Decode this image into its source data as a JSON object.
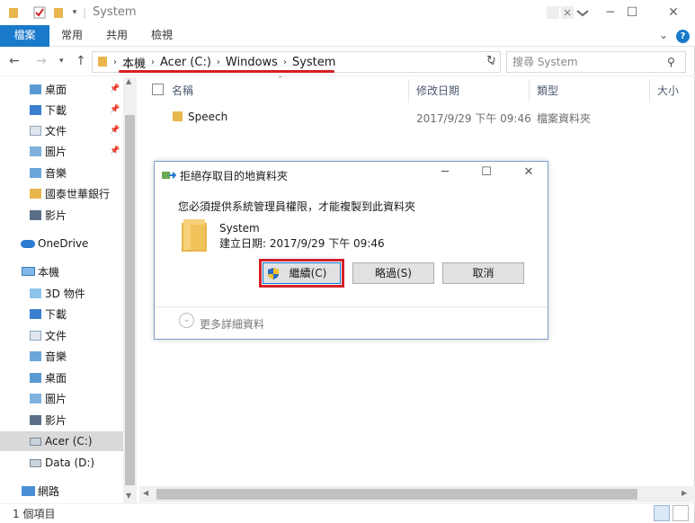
{
  "window": {
    "title": "System"
  },
  "ribbon": {
    "tabs": [
      "檔案",
      "常用",
      "共用",
      "檢視"
    ]
  },
  "address": {
    "crumbs": [
      "本機",
      "Acer (C:)",
      "Windows",
      "System"
    ],
    "search_placeholder": "搜尋 System"
  },
  "sidebar": {
    "quick_access": [
      {
        "label": "桌面",
        "pinned": true
      },
      {
        "label": "下載",
        "pinned": true
      },
      {
        "label": "文件",
        "pinned": true
      },
      {
        "label": "圖片",
        "pinned": true
      },
      {
        "label": "音樂",
        "pinned": false
      },
      {
        "label": "國泰世華銀行",
        "pinned": false
      },
      {
        "label": "影片",
        "pinned": false
      }
    ],
    "onedrive": "OneDrive",
    "this_pc": "本機",
    "pc_items": [
      "3D 物件",
      "下載",
      "文件",
      "音樂",
      "桌面",
      "圖片",
      "影片",
      "Acer (C:)",
      "Data (D:)"
    ],
    "network": "網路"
  },
  "columns": {
    "name": "名稱",
    "modified": "修改日期",
    "type": "類型",
    "size": "大小"
  },
  "rows": [
    {
      "name": "Speech",
      "modified": "2017/9/29 下午 09:46",
      "type": "檔案資料夾"
    }
  ],
  "status": {
    "count": "1 個項目"
  },
  "dialog": {
    "title": "拒絕存取目的地資料夾",
    "message": "您必須提供系統管理員權限，才能複製到此資料夾",
    "folder_name": "System",
    "folder_date": "建立日期: 2017/9/29 下午 09:46",
    "continue": "繼續(C)",
    "skip": "略過(S)",
    "cancel": "取消",
    "more": "更多詳細資料"
  },
  "colors": {
    "accent": "#1979ca",
    "highlight_red": "#d42027",
    "folder": "#e8b64c"
  }
}
